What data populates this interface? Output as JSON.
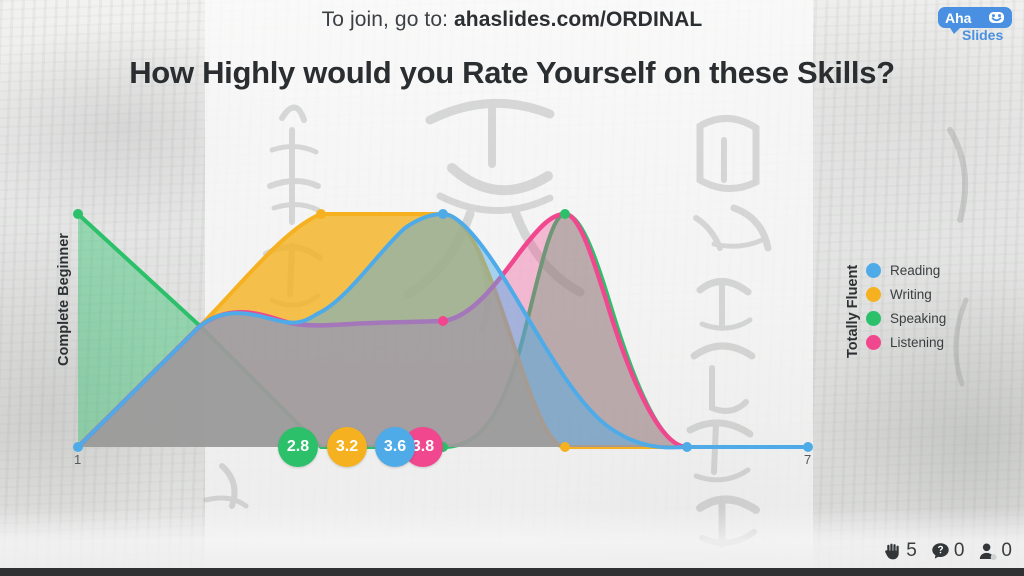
{
  "header": {
    "join_prefix": "To join, go to:",
    "join_url": "ahaslides.com/ORDINAL",
    "logo_top": "Aha",
    "logo_bottom": "Slides"
  },
  "title": "How Highly would you Rate Yourself on these Skills?",
  "legend": {
    "items": [
      {
        "label": "Reading",
        "color": "#4FABE8"
      },
      {
        "label": "Writing",
        "color": "#F5B120"
      },
      {
        "label": "Speaking",
        "color": "#2CC06B"
      },
      {
        "label": "Listening",
        "color": "#F0478F"
      }
    ]
  },
  "badges": [
    {
      "value": "2.8",
      "color": "#2CC06B",
      "series": "Speaking"
    },
    {
      "value": "3.2",
      "color": "#F5B120",
      "series": "Writing"
    },
    {
      "value": "3.6",
      "color": "#4FABE8",
      "series": "Reading"
    },
    {
      "value": "3.8",
      "color": "#F0478F",
      "series": "Listening"
    }
  ],
  "status": {
    "hands_count": "5",
    "questions_count": "0",
    "people_count": "0"
  },
  "chart_data": {
    "type": "line",
    "title": "How Highly would you Rate Yourself on these Skills?",
    "xlabel": "",
    "ylabel": "",
    "x": [
      1,
      2,
      3,
      4,
      5,
      6,
      7
    ],
    "xlim": [
      1,
      7
    ],
    "ylim": [
      0,
      7
    ],
    "grid": false,
    "legend_position": "right",
    "axis_annotations": {
      "left_label": "Complete Beginner",
      "right_label": "Totally Fluent",
      "left_tick": "1",
      "right_tick": "7"
    },
    "area_fill": true,
    "smoothing": "spline",
    "series": [
      {
        "name": "Reading",
        "color": "#4FABE8",
        "mean": "3.6",
        "values": [
          0,
          3.0,
          4.2,
          7.0,
          4.0,
          0,
          0
        ]
      },
      {
        "name": "Writing",
        "color": "#F5B120",
        "mean": "3.2",
        "values": [
          0,
          3.0,
          7.0,
          7.0,
          0,
          0,
          0
        ]
      },
      {
        "name": "Speaking",
        "color": "#2CC06B",
        "mean": "2.8",
        "values": [
          7.0,
          3.1,
          0,
          0,
          7.0,
          0,
          0
        ]
      },
      {
        "name": "Listening",
        "color": "#F0478F",
        "mean": "3.8",
        "values": [
          0,
          3.0,
          3.0,
          2.9,
          7.0,
          0,
          0
        ]
      }
    ]
  }
}
